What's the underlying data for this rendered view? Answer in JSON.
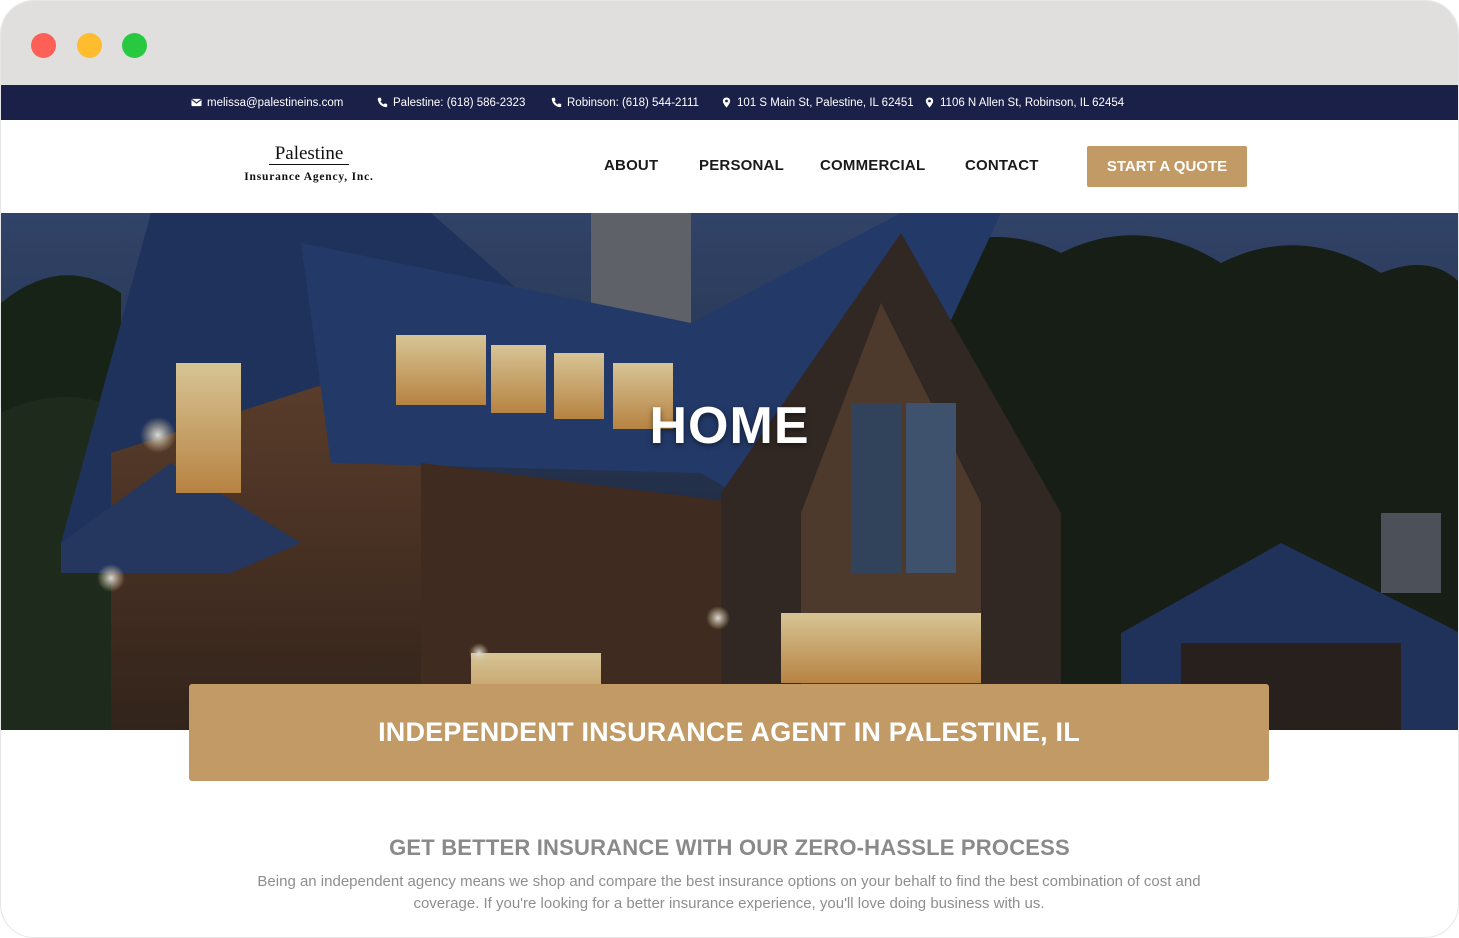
{
  "topbar": {
    "email": "melissa@palestineins.com",
    "phone_palestine": "Palestine: (618) 586-2323",
    "phone_robinson": "Robinson: (618) 544-2111",
    "address_palestine": "101 S Main St, Palestine, IL 62451",
    "address_robinson": "1106 N Allen St, Robinson, IL 62454"
  },
  "logo": {
    "title": "Palestine",
    "subtitle": "Insurance Agency, Inc."
  },
  "nav": {
    "about": "ABOUT",
    "personal": "PERSONAL",
    "commercial": "COMMERCIAL",
    "contact": "CONTACT",
    "quote_button": "START A QUOTE"
  },
  "hero": {
    "title": "HOME"
  },
  "banner": {
    "text": "INDEPENDENT INSURANCE AGENT IN PALESTINE, IL"
  },
  "intro": {
    "heading": "GET BETTER INSURANCE WITH OUR ZERO-HASSLE PROCESS",
    "body": "Being an independent agency means we shop and compare the best insurance options on your behalf to find the best combination of cost and coverage. If you're looking for a better insurance experience, you'll love doing business with us."
  },
  "colors": {
    "navy": "#1b2048",
    "gold": "#c29a65",
    "gray_text": "#8a8a8a"
  }
}
